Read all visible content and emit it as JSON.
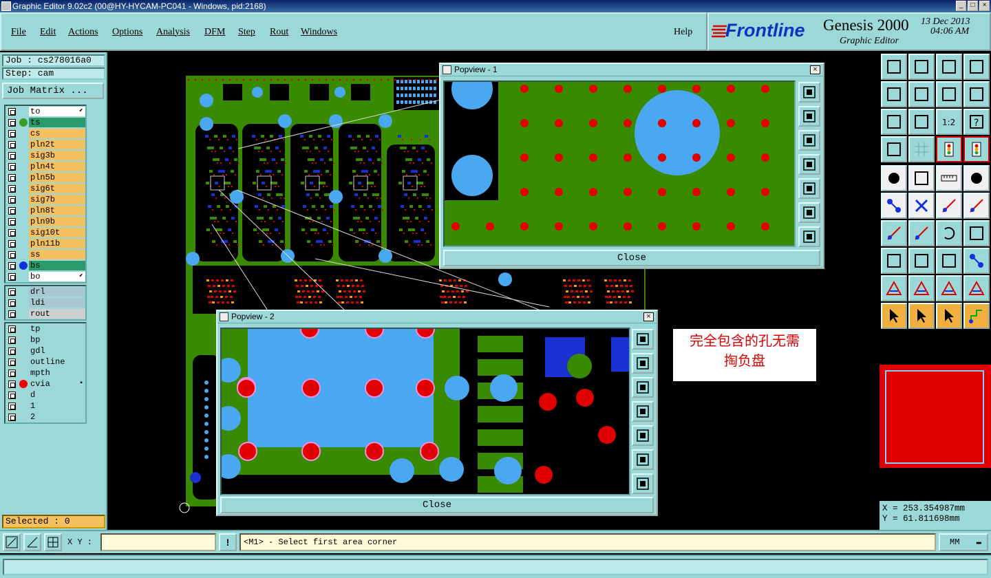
{
  "window": {
    "title": "Graphic Editor 9.02c2 (00@HY-HYCAM-PC041 - Windows, pid:2168)",
    "controls": [
      "_",
      "□",
      "×"
    ]
  },
  "menu": [
    "File",
    "Edit",
    "Actions",
    "Options",
    "Analysis",
    "DFM",
    "Step",
    "Rout",
    "Windows"
  ],
  "help": "Help",
  "brand": {
    "logo": "Frontline",
    "product": "Genesis 2000",
    "date": "13 Dec 2013",
    "time": "04:06 AM",
    "subtitle": "Graphic Editor"
  },
  "job": {
    "job_line": "Job : cs278016a0",
    "step_line": "Step: cam",
    "matrix_button": "Job Matrix ..."
  },
  "layers": {
    "board": [
      {
        "name": "to",
        "color": "#ffffff",
        "dot": "",
        "flag": "⬋"
      },
      {
        "name": "ts",
        "color": "#2a9a6a",
        "dot": "#3a9a2a",
        "flag": ""
      },
      {
        "name": "cs",
        "color": "#f5c060",
        "dot": "",
        "flag": ""
      },
      {
        "name": "pln2t",
        "color": "#f5c060",
        "dot": "",
        "flag": ""
      },
      {
        "name": "sig3b",
        "color": "#f5c060",
        "dot": "",
        "flag": ""
      },
      {
        "name": "pln4t",
        "color": "#f5c060",
        "dot": "",
        "flag": ""
      },
      {
        "name": "pln5b",
        "color": "#f5c060",
        "dot": "",
        "flag": ""
      },
      {
        "name": "sig6t",
        "color": "#f5c060",
        "dot": "",
        "flag": ""
      },
      {
        "name": "sig7b",
        "color": "#f5c060",
        "dot": "",
        "flag": ""
      },
      {
        "name": "pln8t",
        "color": "#f5c060",
        "dot": "",
        "flag": ""
      },
      {
        "name": "pln9b",
        "color": "#f5c060",
        "dot": "",
        "flag": ""
      },
      {
        "name": "sig10t",
        "color": "#f5c060",
        "dot": "",
        "flag": ""
      },
      {
        "name": "pln11b",
        "color": "#f5c060",
        "dot": "",
        "flag": ""
      },
      {
        "name": "ss",
        "color": "#f5c060",
        "dot": "",
        "flag": ""
      },
      {
        "name": "bs",
        "color": "#2a9a6a",
        "dot": "#1030e0",
        "flag": ""
      },
      {
        "name": "bo",
        "color": "#ffffff",
        "dot": "",
        "flag": "⬋"
      }
    ],
    "drill": [
      {
        "name": "drl",
        "color": "#a8c8d0",
        "dot": "",
        "flag": ""
      },
      {
        "name": "ldi",
        "color": "#a8c8d0",
        "dot": "",
        "flag": ""
      },
      {
        "name": "rout",
        "color": "#d0d0d0",
        "dot": "",
        "flag": ""
      }
    ],
    "misc": [
      {
        "name": "tp",
        "color": "#9dd8d8",
        "dot": "",
        "flag": ""
      },
      {
        "name": "bp",
        "color": "#9dd8d8",
        "dot": "",
        "flag": ""
      },
      {
        "name": "gdl",
        "color": "#9dd8d8",
        "dot": "",
        "flag": ""
      },
      {
        "name": "outline",
        "color": "#9dd8d8",
        "dot": "",
        "flag": ""
      },
      {
        "name": "mpth",
        "color": "#9dd8d8",
        "dot": "",
        "flag": ""
      },
      {
        "name": "cvia",
        "color": "#9dd8d8",
        "dot": "#f00000",
        "flag": "▪"
      },
      {
        "name": "d",
        "color": "#9dd8d8",
        "dot": "",
        "flag": ""
      },
      {
        "name": "1",
        "color": "#9dd8d8",
        "dot": "",
        "flag": ""
      },
      {
        "name": "2",
        "color": "#9dd8d8",
        "dot": "",
        "flag": ""
      }
    ]
  },
  "selected": "Selected : 0",
  "popview1": {
    "title": "Popview - 1",
    "close_label": "Close"
  },
  "popview2": {
    "title": "Popview - 2",
    "close_label": "Close"
  },
  "note": {
    "line1": "完全包含的孔无需",
    "line2": "掏负盘"
  },
  "coords": {
    "x": "X = 253.354987mm",
    "y": "Y = 61.811698mm"
  },
  "bottom": {
    "xy_label": "X Y :",
    "xy_value": "",
    "prompt": "<M1> - Select first area corner",
    "units": "MM",
    "status": ""
  },
  "colors": {
    "panel": "#9dd8d8",
    "board": "#3a8a00",
    "pad": "#e00000",
    "copper": "#4aa8f0",
    "trace": "#1a30d0"
  },
  "toolbar_icons": [
    "move-to-front-icon",
    "move-down-icon",
    "home-icon",
    "split-view-icon",
    "move-left-icon",
    "move-right-icon",
    "step-repeat-icon",
    "snake-icon",
    "fit-zoom-icon",
    "center-icon",
    "scale-1-2-icon",
    "help-icon",
    "tools-icon",
    "grid-icon",
    "layers-toggle-icon",
    "layers-toggle-2-icon",
    "pad-snap-icon",
    "line-draw-icon",
    "ruler-icon",
    "circle-pad-icon",
    "connect-nodes-icon",
    "cross-icon",
    "arrow-node-icon",
    "arrow-node-2-icon",
    "angle-icon",
    "slash-icon",
    "rotate-icon",
    "mirror-icon",
    "select-pad-icon",
    "cut-line-icon",
    "measure-box-icon",
    "chain-icon",
    "triangle-icon",
    "triangle-2-icon",
    "triangle-3-icon",
    "triangle-4-icon",
    "pointer-icon",
    "pointer-box-icon",
    "pointer-select-icon",
    "route-icon"
  ]
}
